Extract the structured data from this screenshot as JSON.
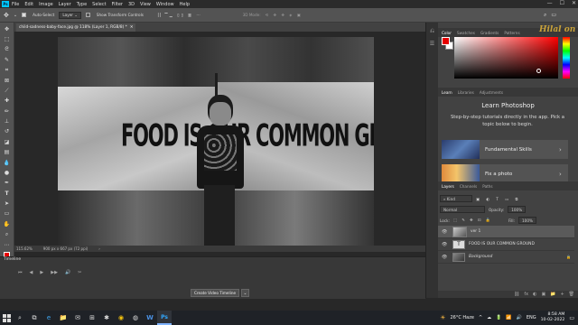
{
  "app": {
    "logo": "Ps"
  },
  "menu": [
    "File",
    "Edit",
    "Image",
    "Layer",
    "Type",
    "Select",
    "Filter",
    "3D",
    "View",
    "Window",
    "Help"
  ],
  "window_controls": {
    "minimize": "—",
    "maximize": "☐",
    "close": "✕"
  },
  "options_bar": {
    "auto_select_label": "Auto-Select",
    "auto_select_value": "Layer",
    "transform_controls_label": "Show Transform Controls",
    "mode_3d": "3D Mode:"
  },
  "document_tab": {
    "title": "child-sadness-baby-face.jpg @ 118% (Layer 1, RGB/8) *",
    "close": "✕"
  },
  "canvas": {
    "headline": "FOOD IS OUR COMMON GROUND"
  },
  "status_bar": {
    "zoom": "115.62%",
    "doc_size": "900 px x 667 px (72 ppi)",
    "arrow": "›"
  },
  "timeline": {
    "title": "Timeline",
    "controls": [
      "⏮",
      "◀",
      "▶",
      "▶▶",
      "🔊",
      "✂"
    ],
    "create_button": "Create Video Timeline",
    "dropdown": "⌄"
  },
  "color_panel": {
    "tabs": [
      "Color",
      "Swatches",
      "Gradients",
      "Patterns"
    ],
    "foreground": "#e60000",
    "background": "#ffffff"
  },
  "learn_panel": {
    "tabs": [
      "Learn",
      "Libraries",
      "Adjustments"
    ],
    "title": "Learn Photoshop",
    "description": "Step-by-step tutorials directly in the app. Pick a topic below to begin.",
    "cards": [
      {
        "label": "Fundamental Skills",
        "chevron": "›"
      },
      {
        "label": "Fix a photo",
        "chevron": "›"
      }
    ]
  },
  "layers_panel": {
    "tabs": [
      "Layers",
      "Channels",
      "Paths"
    ],
    "filter_label": "Kind",
    "blend_mode": "Normal",
    "opacity_label": "Opacity:",
    "opacity_value": "100%",
    "lock_label": "Lock:",
    "fill_label": "Fill:",
    "fill_value": "100%",
    "layers": [
      {
        "name": "ver 1",
        "selected": true
      },
      {
        "name": "FOOD IS OUR COMMON GROUND",
        "selected": false,
        "thumb": "T"
      },
      {
        "name": "Background",
        "selected": false,
        "lock": "🔒"
      }
    ],
    "bottom_icons": [
      "⛓",
      "fx",
      "◐",
      "▣",
      "📁",
      "+",
      "🗑"
    ]
  },
  "watermark": "Hilal on",
  "taskbar": {
    "search_icon": "⌕",
    "apps": [
      "⧉",
      "e",
      "📁",
      "✉",
      "⊞",
      "✱",
      "◉",
      "◍",
      "W",
      "Ps"
    ],
    "weather": "26°C Haze",
    "language": "ENG",
    "time": "8:58 AM",
    "date": "10-02-2022",
    "tray_icons": [
      "^",
      "☁",
      "🔋",
      "📶",
      "🔊"
    ]
  }
}
